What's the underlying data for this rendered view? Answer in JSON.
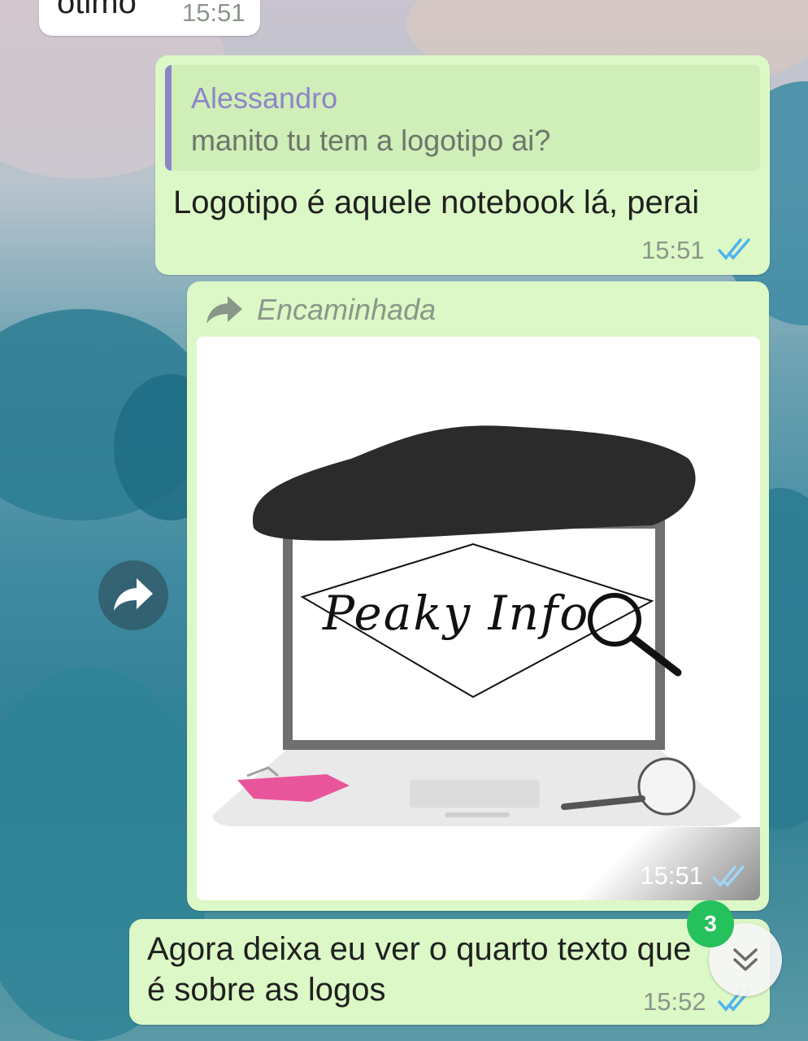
{
  "messages": [
    {
      "text": "ótimo",
      "time": "15:51"
    },
    {
      "reply": {
        "author": "Alessandro",
        "text": "manito tu tem a logotipo ai?"
      },
      "text": "Logotipo é aquele notebook lá, perai",
      "time": "15:51",
      "status": "read"
    },
    {
      "forwarded_label": "Encaminhada",
      "image": {
        "logo_text": "Peaky Info",
        "description_icon": "notebook-logo-image"
      },
      "time": "15:51",
      "status": "read"
    },
    {
      "text_line1": "Agora deixa eu ver o quarto texto que",
      "text_line2": "é sobre as logos",
      "time": "15:52",
      "status": "read"
    }
  ],
  "scroll_down": {
    "unread_count": "3",
    "icon": "double-chevron-down-icon"
  },
  "forward_button_icon": "share-arrow-icon",
  "colors": {
    "outgoing_bubble": "#dcf8c6",
    "incoming_bubble": "#ffffff",
    "read_ticks": "#4fb3f0",
    "quote_author": "#8e85c7",
    "badge": "#25c15c"
  }
}
